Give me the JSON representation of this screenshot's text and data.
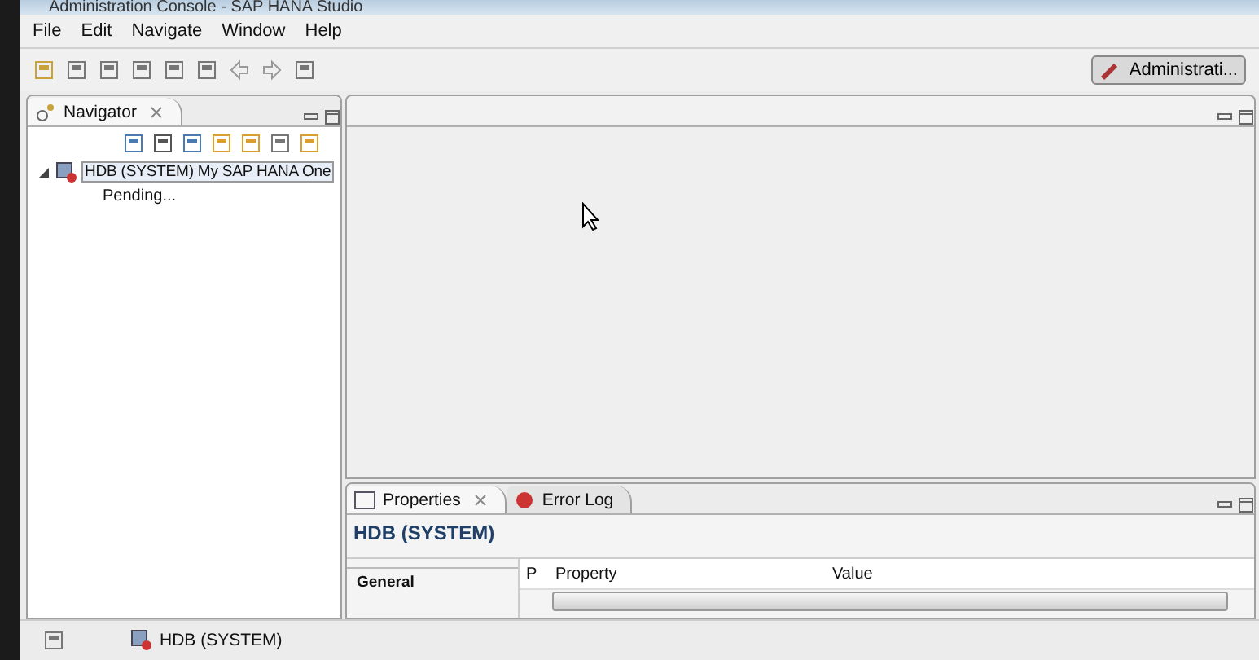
{
  "window": {
    "title": "Administration Console - SAP HANA Studio"
  },
  "menu": [
    "File",
    "Edit",
    "Navigate",
    "Window",
    "Help"
  ],
  "perspective": {
    "label": "Administrati...",
    "selected": true
  },
  "navigator": {
    "tab": "Navigator",
    "tree": [
      {
        "label": "HDB (SYSTEM) My SAP HANA One",
        "selected": true,
        "expanded": true,
        "children": [
          {
            "label": "Pending..."
          }
        ]
      }
    ]
  },
  "properties": {
    "tabs": [
      {
        "label": "Properties",
        "selected": true
      },
      {
        "label": "Error Log",
        "selected": false
      }
    ],
    "heading": "HDB (SYSTEM)",
    "section": "General",
    "columns": [
      "P",
      "Property",
      "Value"
    ]
  },
  "status_bar": {
    "item": "HDB (SYSTEM)"
  }
}
